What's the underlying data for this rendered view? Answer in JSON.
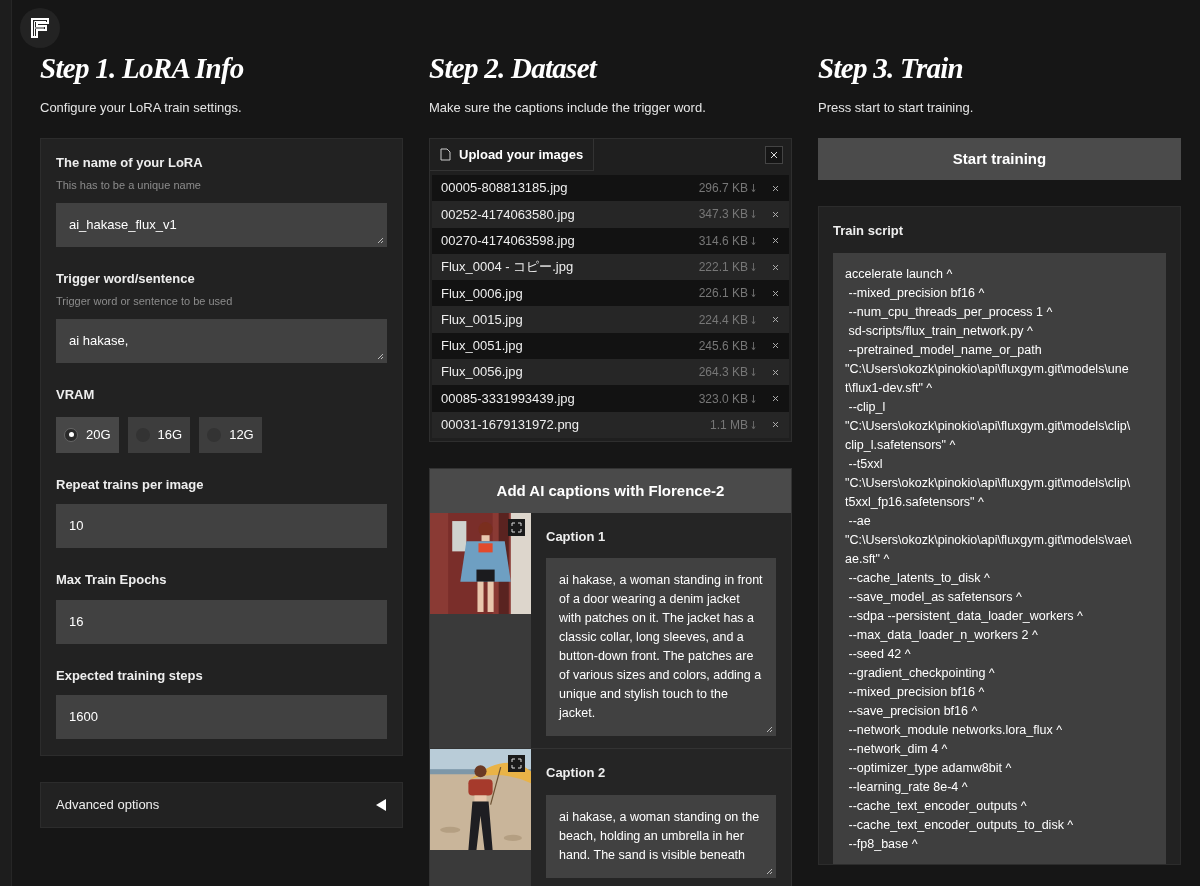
{
  "steps": [
    {
      "title": "Step 1. LoRA Info",
      "subtitle": "Configure your LoRA train settings."
    },
    {
      "title": "Step 2. Dataset",
      "subtitle": "Make sure the captions include the trigger word."
    },
    {
      "title": "Step 3. Train",
      "subtitle": "Press start to start training."
    }
  ],
  "lora_info": {
    "fields": [
      {
        "kind": "textarea",
        "label": "The name of your LoRA",
        "hint": "This has to be a unique name",
        "value": "ai_hakase_flux_v1"
      },
      {
        "kind": "textarea",
        "label": "Trigger word/sentence",
        "hint": "Trigger word or sentence to be used",
        "value": "ai hakase,"
      },
      {
        "kind": "radio",
        "label": "VRAM",
        "options": [
          {
            "label": "20G",
            "selected": true
          },
          {
            "label": "16G",
            "selected": false
          },
          {
            "label": "12G",
            "selected": false
          }
        ]
      },
      {
        "kind": "number",
        "label": "Repeat trains per image",
        "value": "10"
      },
      {
        "kind": "number",
        "label": "Max Train Epochs",
        "value": "16"
      },
      {
        "kind": "number",
        "label": "Expected training steps",
        "value": "1600"
      }
    ]
  },
  "advanced": {
    "label": "Advanced options",
    "expanded": false
  },
  "dataset": {
    "upload_label": "Upload your images",
    "files": [
      {
        "name": "00005-808813185.jpg",
        "size": "296.7 KB"
      },
      {
        "name": "00252-4174063580.jpg",
        "size": "347.3 KB"
      },
      {
        "name": "00270-4174063598.jpg",
        "size": "314.6 KB"
      },
      {
        "name": "Flux_0004 - コピー.jpg",
        "size": "222.1 KB"
      },
      {
        "name": "Flux_0006.jpg",
        "size": "226.1 KB"
      },
      {
        "name": "Flux_0015.jpg",
        "size": "224.4 KB"
      },
      {
        "name": "Flux_0051.jpg",
        "size": "245.6 KB"
      },
      {
        "name": "Flux_0056.jpg",
        "size": "264.3 KB"
      },
      {
        "name": "00085-3331993439.jpg",
        "size": "323.0 KB"
      },
      {
        "name": "00031-1679131972.png",
        "size": "1.1 MB"
      }
    ],
    "captions": {
      "title": "Add AI captions with Florence-2",
      "items": [
        {
          "label": "Caption 1",
          "text": "ai hakase, a woman standing in front of a door wearing a denim jacket with patches on it. The jacket has a classic collar, long sleeves, and a button-down front. The patches are of various sizes and colors, adding a unique and stylish touch to the jacket.",
          "kind": "picture"
        },
        {
          "label": "Caption 2",
          "text": "ai hakase, a woman standing on the beach, holding an umbrella in her hand. The sand is visible beneath",
          "kind": "picture"
        }
      ]
    }
  },
  "train": {
    "button": "Start training",
    "script_label": "Train script",
    "script_lines": [
      "accelerate launch ^",
      " --mixed_precision bf16 ^",
      " --num_cpu_threads_per_process 1 ^",
      " sd-scripts/flux_train_network.py ^",
      " --pretrained_model_name_or_path",
      "\"C:\\Users\\okozk\\pinokio\\api\\fluxgym.git\\models\\une",
      "t\\flux1-dev.sft\" ^",
      " --clip_l",
      "\"C:\\Users\\okozk\\pinokio\\api\\fluxgym.git\\models\\clip\\",
      "clip_l.safetensors\" ^",
      " --t5xxl",
      "\"C:\\Users\\okozk\\pinokio\\api\\fluxgym.git\\models\\clip\\",
      "t5xxl_fp16.safetensors\" ^",
      " --ae",
      "\"C:\\Users\\okozk\\pinokio\\api\\fluxgym.git\\models\\vae\\",
      "ae.sft\" ^",
      " --cache_latents_to_disk ^",
      " --save_model_as safetensors ^",
      " --sdpa --persistent_data_loader_workers ^",
      " --max_data_loader_n_workers 2 ^",
      " --seed 42 ^",
      " --gradient_checkpointing ^",
      " --mixed_precision bf16 ^",
      " --save_precision bf16 ^",
      " --network_module networks.lora_flux ^",
      " --network_dim 4 ^",
      " --optimizer_type adamw8bit ^",
      " --learning_rate 8e-4 ^",
      " --cache_text_encoder_outputs ^",
      " --cache_text_encoder_outputs_to_disk ^",
      " --fp8_base ^"
    ]
  }
}
